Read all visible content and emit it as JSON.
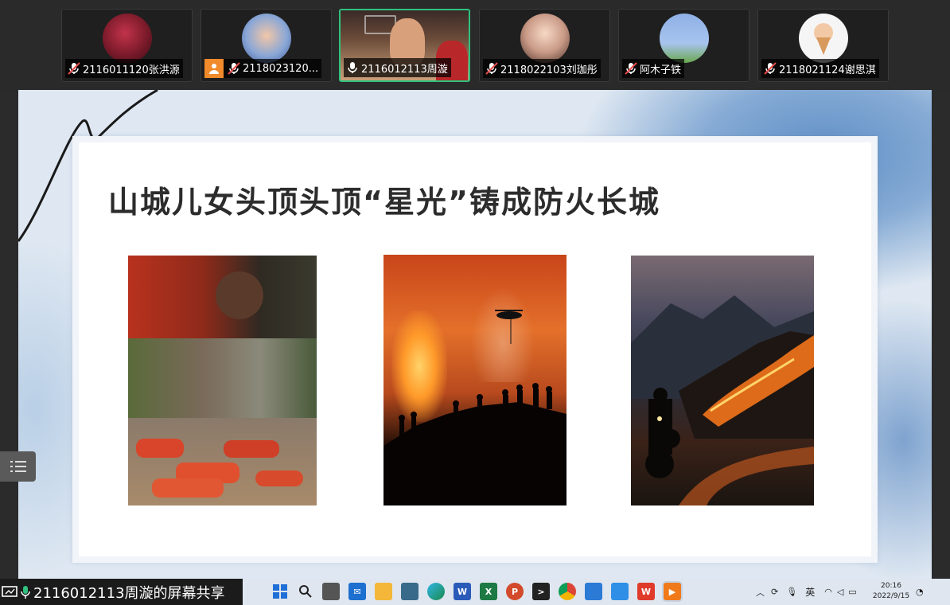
{
  "participants": [
    {
      "name": "2116011120张洪源",
      "muted": true,
      "avatar": "dark-red-portrait",
      "active": false
    },
    {
      "name": "2118023120...",
      "muted": true,
      "avatar": "cartoon-girl-portrait",
      "active": false,
      "badge": "person-icon"
    },
    {
      "name": "2116012113周漩",
      "muted": false,
      "avatar": "basketball-video",
      "active": true
    },
    {
      "name": "2118022103刘珈彤",
      "muted": true,
      "avatar": "girl-portrait",
      "active": false
    },
    {
      "name": "阿木子铁",
      "muted": true,
      "avatar": "cartoon-sign-portrait",
      "active": false
    },
    {
      "name": "2118021124谢思淇",
      "muted": true,
      "avatar": "ice-cream-cartoon",
      "active": false
    }
  ],
  "slide": {
    "title": "山城儿女头顶头顶“星光”铸成防火长城",
    "photos": [
      "firefighters-resting-photo",
      "forest-fire-silhouettes-photo",
      "motorcycle-fire-night-photo"
    ]
  },
  "share_banner": {
    "label": "2116012113周漩的屏幕共享"
  },
  "taskbar": {
    "apps": [
      "start-icon",
      "search-icon",
      "task-view-icon",
      "mail-icon",
      "file-explorer-icon",
      "app-icon",
      "edge-icon",
      "word-icon",
      "excel-icon",
      "powerpoint-icon",
      "terminal-icon",
      "chrome-icon",
      "app-icon",
      "app-icon",
      "wps-icon",
      "player-icon"
    ],
    "ime": "英",
    "time": "20:16",
    "date": "2022/9/15"
  },
  "colors": {
    "active_border": "#2ec27e",
    "slide_bg": "#dfe8f2",
    "taskbar": "#dfe6ef"
  }
}
